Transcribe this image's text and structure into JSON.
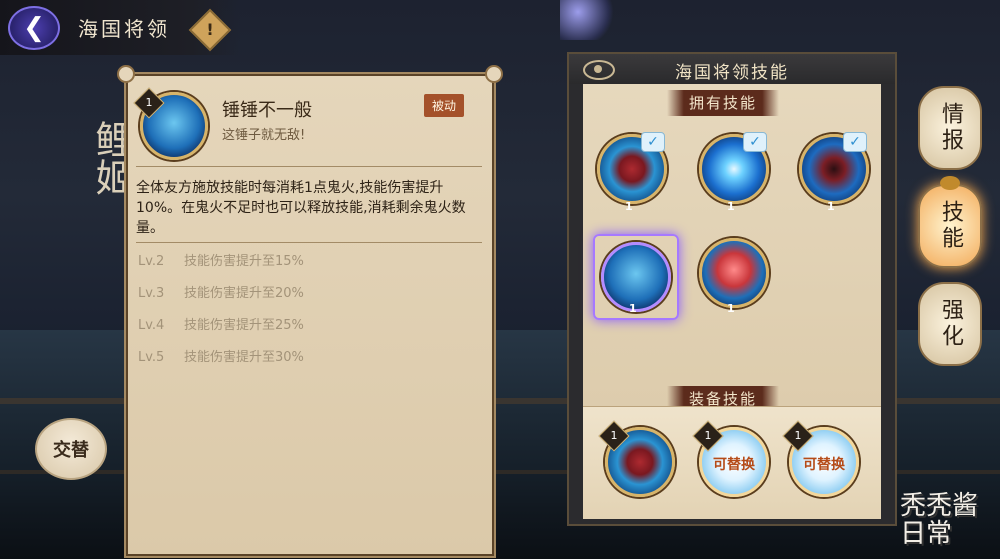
{
  "header": {
    "title": "海国将领",
    "info_icon": "!",
    "back_icon": "back-arrow"
  },
  "background": {
    "character_name": "鲤姬"
  },
  "left": {
    "swap_label": "交替"
  },
  "detail": {
    "level": "1",
    "name": "锤锤不一般",
    "subtitle": "这锤子就无敌!",
    "tag": "被动",
    "description": "全体友方施放技能时每消耗1点鬼火,技能伤害提升10%。在鬼火不足时也可以释放技能,消耗剩余鬼火数量。",
    "levels": [
      {
        "lv": "Lv.2",
        "text": "技能伤害提升至15%"
      },
      {
        "lv": "Lv.3",
        "text": "技能伤害提升至20%"
      },
      {
        "lv": "Lv.4",
        "text": "技能伤害提升至25%"
      },
      {
        "lv": "Lv.5",
        "text": "技能伤害提升至30%"
      }
    ]
  },
  "skills_panel": {
    "title": "海国将领技能",
    "owned_label": "拥有技能",
    "owned": [
      {
        "icon": "claw",
        "count": "1",
        "checked": true
      },
      {
        "icon": "burst",
        "count": "1",
        "checked": true
      },
      {
        "icon": "urchin",
        "count": "1",
        "checked": true
      },
      {
        "icon": "hammer",
        "count": "1",
        "checked": false,
        "selected": true
      },
      {
        "icon": "crab",
        "count": "1",
        "checked": false
      }
    ],
    "equip_label": "装备技能",
    "equipped": [
      {
        "icon": "claw",
        "level": "1",
        "text": ""
      },
      {
        "icon": "replace",
        "level": "1",
        "text": "可替换"
      },
      {
        "icon": "replace",
        "level": "1",
        "text": "可替换"
      }
    ]
  },
  "side_tabs": [
    {
      "label": "情报",
      "active": false
    },
    {
      "label": "技能",
      "active": true
    },
    {
      "label": "强化",
      "active": false
    }
  ],
  "watermark": "秃秃酱日常",
  "colors": {
    "accent": "#a679ff",
    "tag_bg": "#a4512a",
    "panel_bg": "#e5d6bb"
  }
}
